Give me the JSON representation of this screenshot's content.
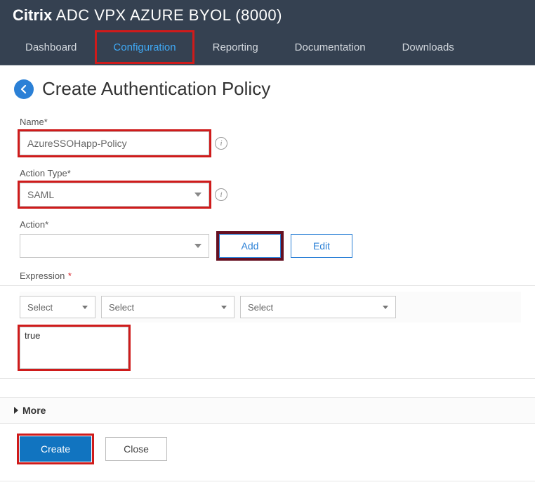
{
  "header": {
    "brand_bold": "Citrix",
    "brand_rest": " ADC VPX AZURE BYOL (8000)"
  },
  "nav": {
    "items": [
      "Dashboard",
      "Configuration",
      "Reporting",
      "Documentation",
      "Downloads"
    ],
    "active_index": 1
  },
  "page": {
    "title": "Create Authentication Policy"
  },
  "form": {
    "name_label": "Name",
    "name_value": "AzureSSOHapp-Policy",
    "action_type_label": "Action Type",
    "action_type_value": "SAML",
    "action_label": "Action",
    "action_value": "",
    "add_btn": "Add",
    "edit_btn": "Edit",
    "expression_label": "Expression",
    "expr_sel1": "Select",
    "expr_sel2": "Select",
    "expr_sel3": "Select",
    "expr_text": "true",
    "more_label": "More",
    "create_btn": "Create",
    "close_btn": "Close"
  }
}
